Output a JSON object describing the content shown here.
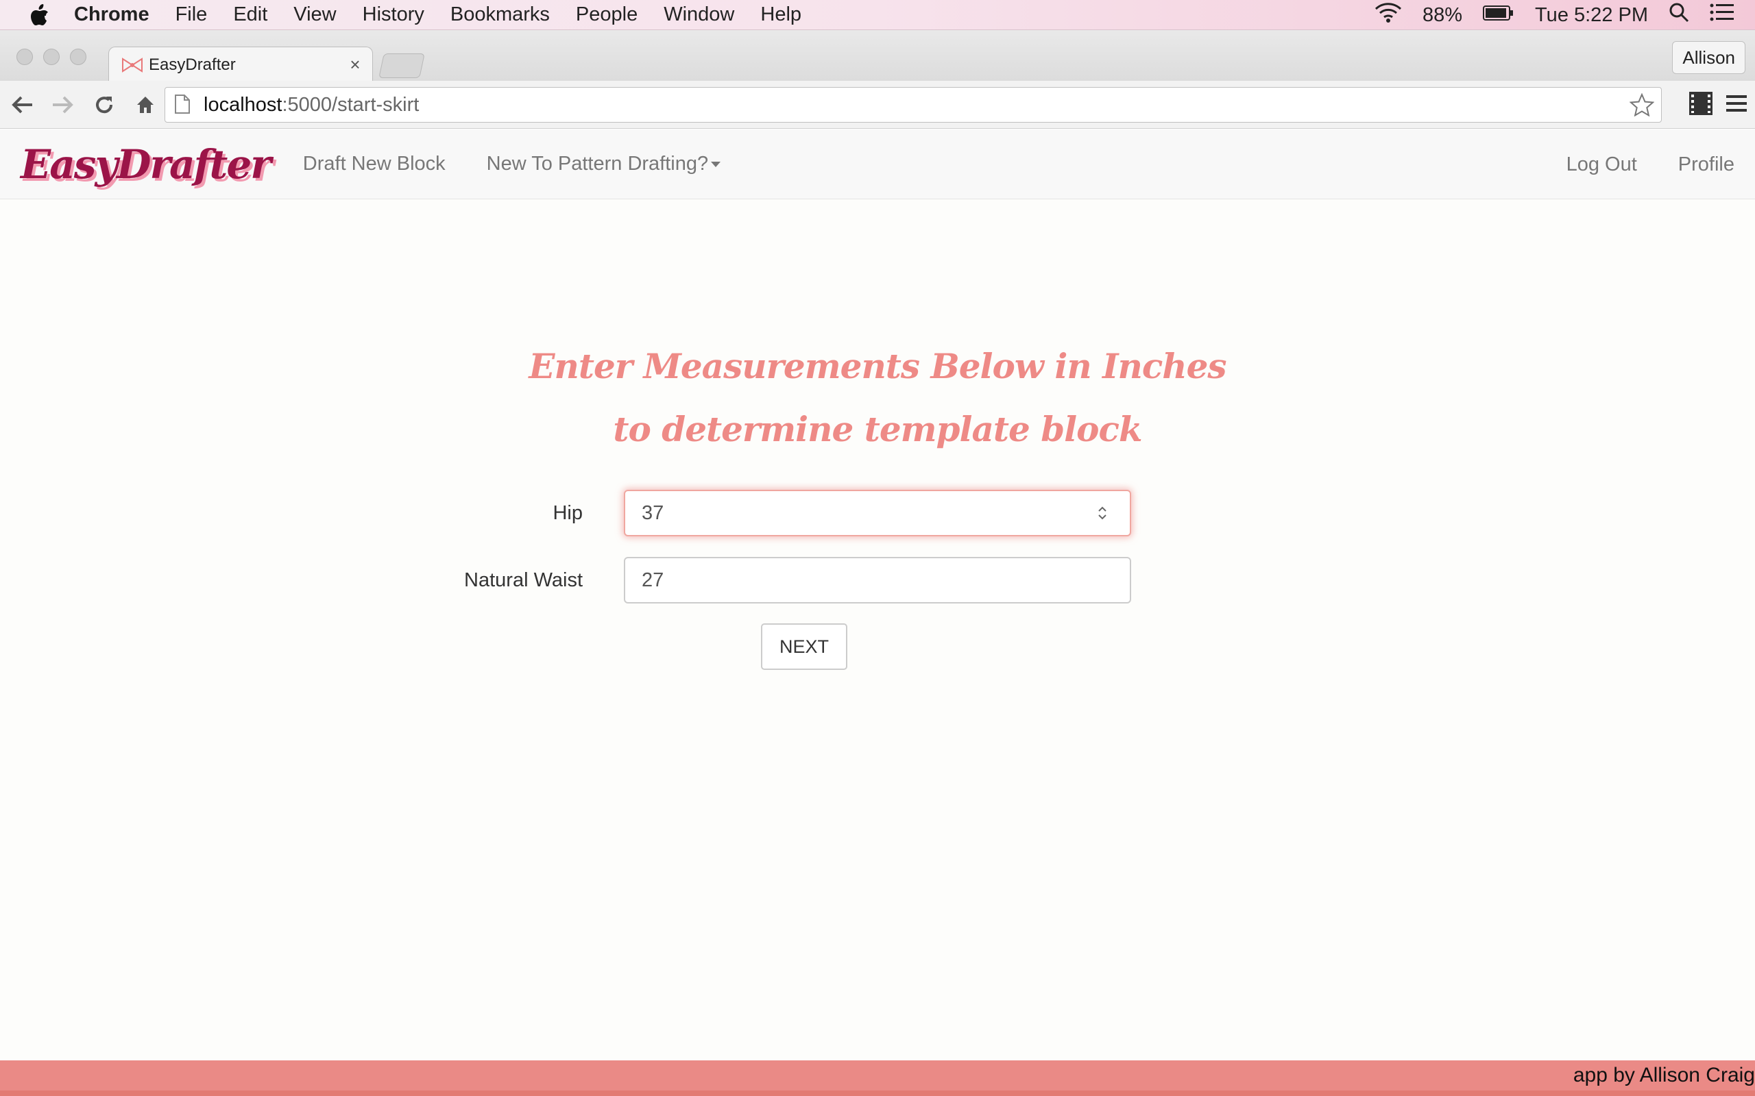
{
  "menubar": {
    "app_name": "Chrome",
    "items": [
      "File",
      "Edit",
      "View",
      "History",
      "Bookmarks",
      "People",
      "Window",
      "Help"
    ],
    "battery": "88%",
    "clock": "Tue 5:22 PM"
  },
  "browser": {
    "tab_title": "EasyDrafter",
    "profile_name": "Allison",
    "url_host": "localhost",
    "url_rest": ":5000/start-skirt"
  },
  "site": {
    "brand": "EasyDrafter",
    "nav": {
      "draft_new_block": "Draft New Block",
      "new_to_pattern": "New To Pattern Drafting?",
      "log_out": "Log Out",
      "profile": "Profile"
    },
    "heading_line1": "Enter Measurements Below in Inches",
    "heading_line2": "to determine template block",
    "form": {
      "hip_label": "Hip",
      "hip_value": "37",
      "waist_label": "Natural Waist",
      "waist_value": "27",
      "next_label": "NEXT"
    },
    "footer_credit": "app by Allison Craig"
  },
  "colors": {
    "brand": "#9b1448",
    "heading": "#ee8a86",
    "footer": "#ea8a86"
  }
}
